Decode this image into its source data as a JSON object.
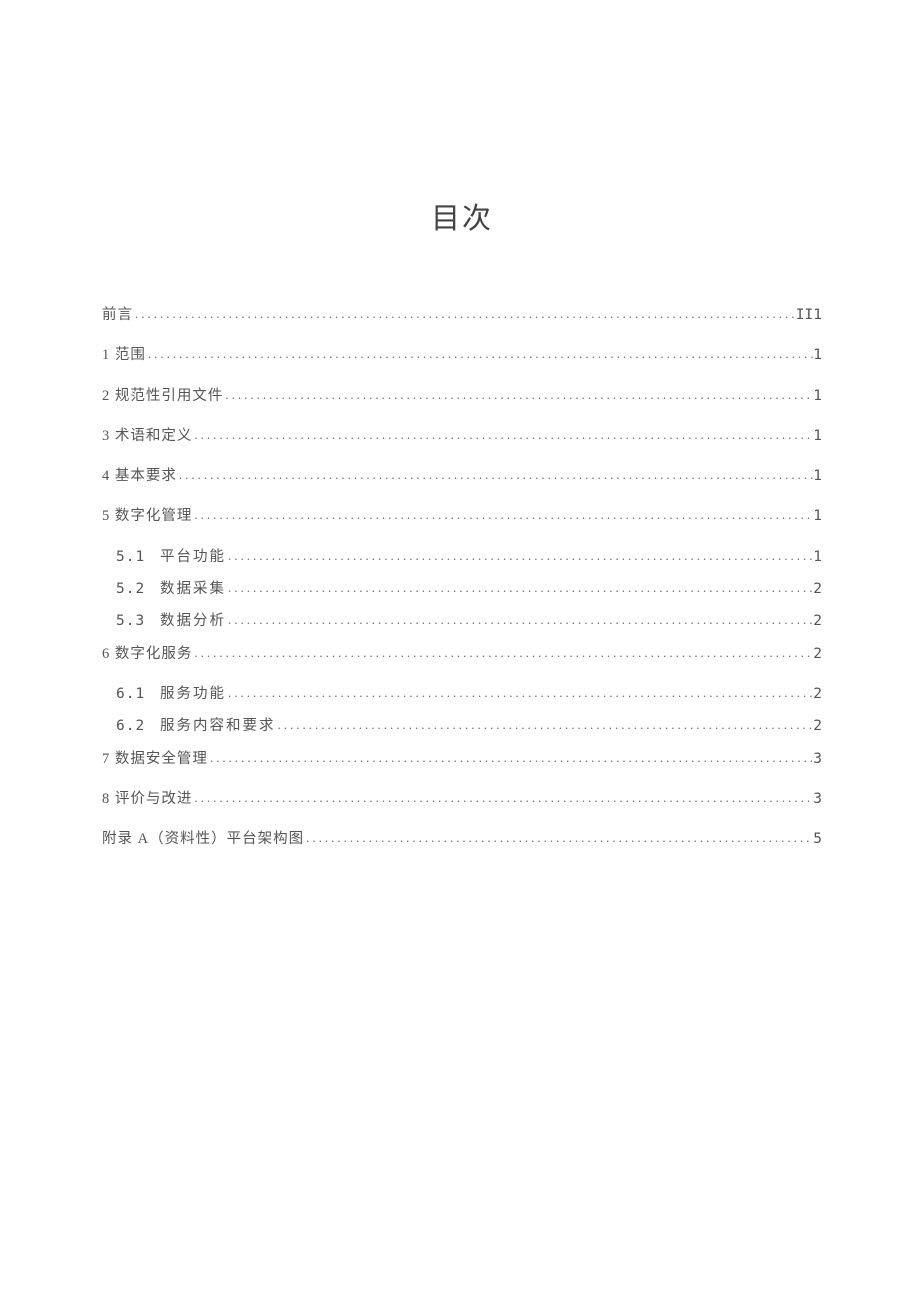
{
  "title": "目次",
  "entries": [
    {
      "label": "前言",
      "page": "II1",
      "indent": 0
    },
    {
      "label": "1 范围",
      "page": "1",
      "indent": 0
    },
    {
      "label": "2 规范性引用文件",
      "page": "1",
      "indent": 0
    },
    {
      "label": "3 术语和定义",
      "page": "1",
      "indent": 0
    },
    {
      "label": "4 基本要求",
      "page": "1",
      "indent": 0
    },
    {
      "label": "5 数字化管理",
      "page": "1",
      "indent": 0
    },
    {
      "num": "5.1",
      "label": "平台功能",
      "page": "1",
      "indent": 1
    },
    {
      "num": "5.2",
      "label": "数据采集",
      "page": "2",
      "indent": 1
    },
    {
      "num": "5.3",
      "label": "数据分析",
      "page": "2",
      "indent": 1
    },
    {
      "label": "6 数字化服务",
      "page": "2",
      "indent": 0
    },
    {
      "num": "6.1",
      "label": "服务功能",
      "page": "2",
      "indent": 1
    },
    {
      "num": "6.2",
      "label": "服务内容和要求",
      "page": "2",
      "indent": 1
    },
    {
      "label": "7 数据安全管理",
      "page": "3",
      "indent": 0
    },
    {
      "label": "8 评价与改进",
      "page": "3",
      "indent": 0
    },
    {
      "label": "附录 A（资料性）平台架构图",
      "page": "5",
      "indent": 0
    }
  ]
}
